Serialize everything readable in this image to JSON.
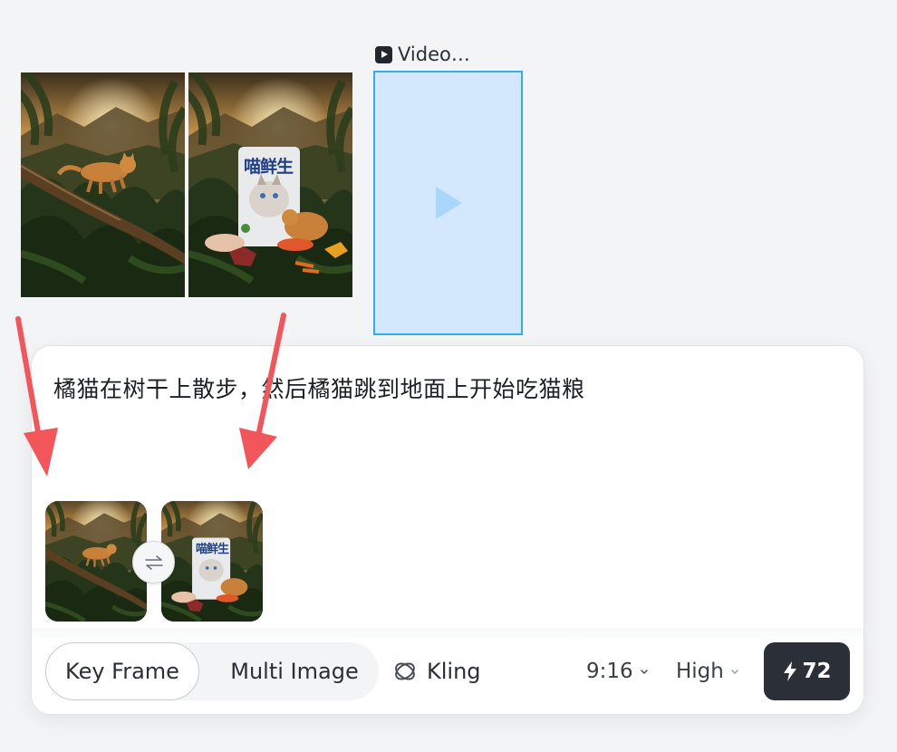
{
  "video_node": {
    "label": "Video…",
    "icon": "video-icon",
    "play_icon": "play-icon",
    "accent": "#2fb0ee",
    "fill": "#d4e8fd"
  },
  "reference_images": [
    {
      "name": "orange cat walking on tree branch in jungle at sunset"
    },
    {
      "name": "orange cat eating from bowl beside cat food bag",
      "bag_text": "喵鲜生"
    }
  ],
  "prompt": {
    "text": "橘猫在树干上散步，然后橘猫跳到地面上开始吃猫粮"
  },
  "frames": {
    "start": {
      "name": "start-frame"
    },
    "end": {
      "name": "end-frame",
      "bag_text": "喵鲜生"
    },
    "swap_icon": "swap-icon"
  },
  "toolbar": {
    "mode_tabs": [
      {
        "label": "Key Frame",
        "selected": true
      },
      {
        "label": "Multi Image",
        "selected": false
      }
    ],
    "model": {
      "label": "Kling",
      "icon": "kling-logo-icon"
    },
    "aspect_ratio": {
      "value": "9:16",
      "icon": "chevron-down-icon"
    },
    "quality": {
      "value": "High",
      "icon": "chevron-down-icon"
    },
    "generate": {
      "credits": "72",
      "icon": "lightning-icon"
    }
  },
  "annotations": {
    "arrow_color": "#f2555a"
  }
}
